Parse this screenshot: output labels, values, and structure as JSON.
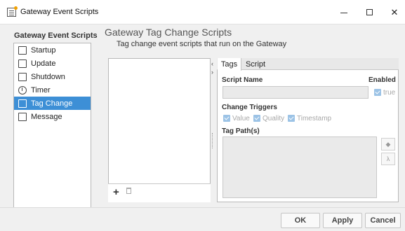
{
  "window": {
    "title": "Gateway Event Scripts",
    "minimize": "–",
    "close": "✕"
  },
  "left": {
    "heading": "Gateway Event Scripts",
    "items": [
      {
        "label": "Startup",
        "icon": "script-icon"
      },
      {
        "label": "Update",
        "icon": "script-icon"
      },
      {
        "label": "Shutdown",
        "icon": "script-icon"
      },
      {
        "label": "Timer",
        "icon": "clock-icon"
      },
      {
        "label": "Tag Change",
        "icon": "tag-script-icon",
        "selected": true
      },
      {
        "label": "Message",
        "icon": "message-icon"
      }
    ]
  },
  "main": {
    "title": "Gateway Tag Change Scripts",
    "subtitle": "Tag change event scripts that run on the Gateway"
  },
  "list_toolbar": {
    "add": "+",
    "collapse_left": "‹",
    "collapse_right": "›"
  },
  "tabs": {
    "tags": "Tags",
    "script": "Script",
    "active": "Tags"
  },
  "form": {
    "script_name_label": "Script Name",
    "script_name_value": "",
    "enabled_label": "Enabled",
    "enabled_value_label": "true",
    "enabled_checked": true,
    "change_triggers_label": "Change Triggers",
    "triggers": [
      {
        "label": "Value",
        "checked": true
      },
      {
        "label": "Quality",
        "checked": true
      },
      {
        "label": "Timestamp",
        "checked": true
      }
    ],
    "tag_paths_label": "Tag Path(s)",
    "tag_paths_value": "",
    "tag_browse_icon": "tag-icon",
    "tag_alt_icon": "lambda-icon"
  },
  "buttons": {
    "ok": "OK",
    "apply": "Apply",
    "cancel": "Cancel"
  },
  "colors": {
    "selection": "#3d8fd6",
    "checkbox": "#9cc3e6"
  }
}
